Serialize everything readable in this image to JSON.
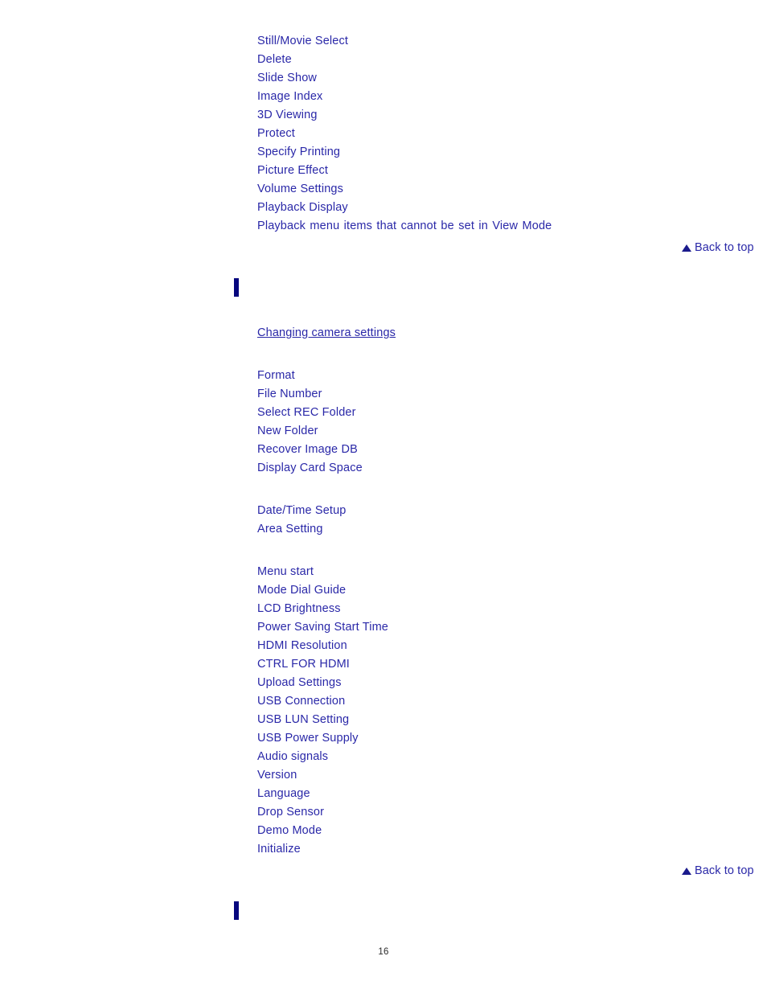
{
  "document": {
    "page_number": "16",
    "link_color": "#2a28a8",
    "bar_color": "#06067e",
    "page_number_color": "#2b2b2b"
  },
  "playback_section": {
    "items": [
      {
        "label": "Still/Movie Select"
      },
      {
        "label": "Delete"
      },
      {
        "label": "Slide Show"
      },
      {
        "label": "Image Index"
      },
      {
        "label": "3D Viewing"
      },
      {
        "label": "Protect"
      },
      {
        "label": "Specify Printing"
      },
      {
        "label": "Picture Effect"
      },
      {
        "label": "Volume Settings"
      },
      {
        "label": "Playback Display"
      },
      {
        "label": "Playback menu items that cannot be set in View Mode"
      }
    ],
    "back_to_top": {
      "label": "Back to top",
      "icon": "triangle-up-icon"
    }
  },
  "settings_section": {
    "heading_link": "Changing camera settings",
    "memory_card_group": [
      {
        "label": "Format"
      },
      {
        "label": "File Number"
      },
      {
        "label": "Select REC Folder"
      },
      {
        "label": "New Folder"
      },
      {
        "label": "Recover Image DB"
      },
      {
        "label": "Display Card Space"
      }
    ],
    "clock_group": [
      {
        "label": "Date/Time Setup"
      },
      {
        "label": "Area Setting"
      }
    ],
    "setup_group": [
      {
        "label": "Menu start"
      },
      {
        "label": "Mode Dial Guide"
      },
      {
        "label": "LCD Brightness"
      },
      {
        "label": "Power Saving Start Time"
      },
      {
        "label": "HDMI Resolution"
      },
      {
        "label": "CTRL FOR HDMI"
      },
      {
        "label": "Upload Settings"
      },
      {
        "label": "USB Connection"
      },
      {
        "label": "USB LUN Setting"
      },
      {
        "label": "USB Power Supply"
      },
      {
        "label": "Audio signals"
      },
      {
        "label": "Version"
      },
      {
        "label": "Language"
      },
      {
        "label": "Drop Sensor"
      },
      {
        "label": "Demo Mode"
      },
      {
        "label": "Initialize"
      }
    ],
    "back_to_top": {
      "label": "Back to top",
      "icon": "triangle-up-icon"
    }
  }
}
